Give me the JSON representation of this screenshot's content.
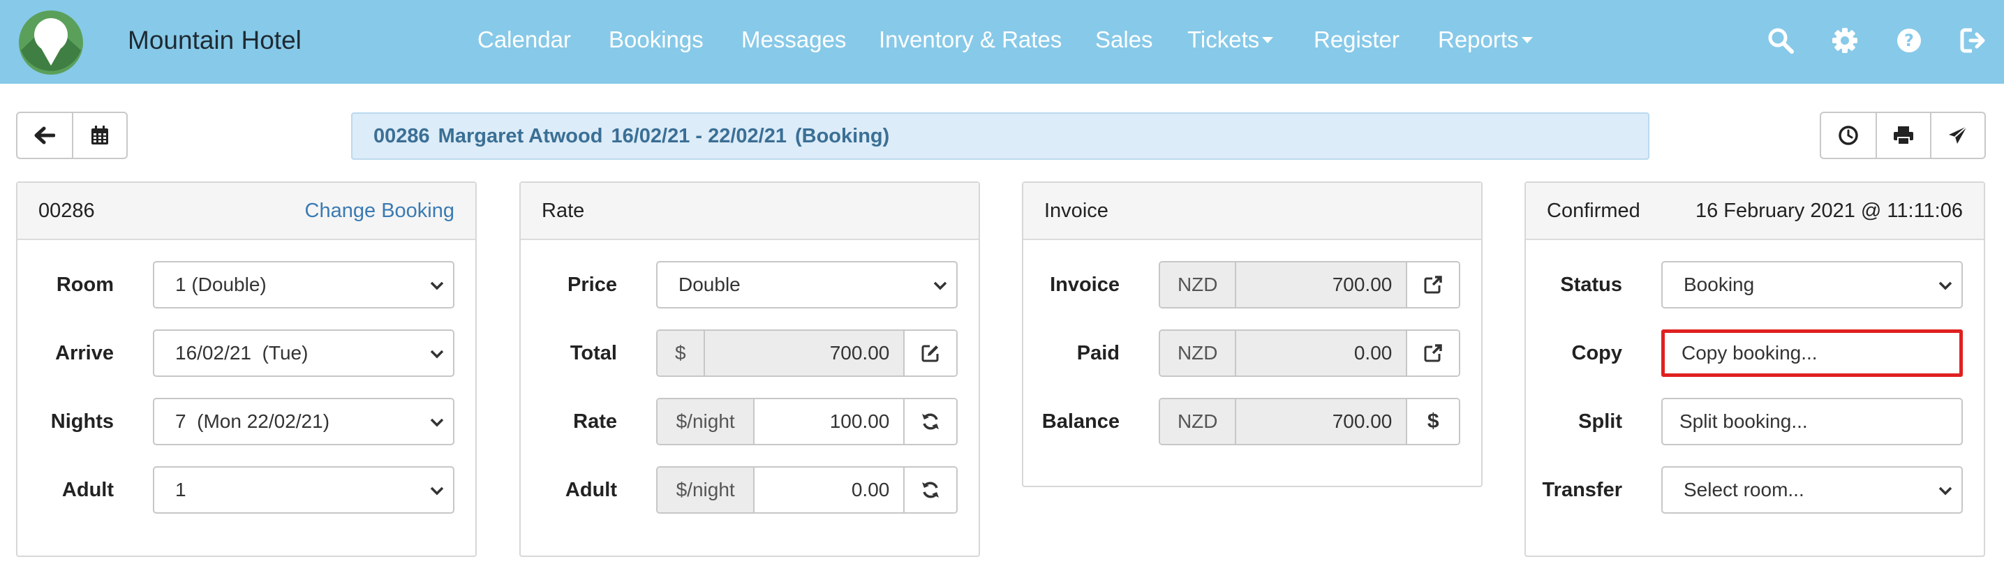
{
  "app": {
    "brand": "Mountain Hotel",
    "colors": {
      "navbar": "#87c9e8",
      "info_bar": "#dcecf8",
      "link": "#3a7ab3",
      "highlight": "#e02020"
    }
  },
  "nav": {
    "items": [
      {
        "label": "Calendar"
      },
      {
        "label": "Bookings"
      },
      {
        "label": "Messages"
      },
      {
        "label": "Inventory & Rates"
      },
      {
        "label": "Sales"
      },
      {
        "label": "Tickets",
        "dropdown": true
      },
      {
        "label": "Register"
      },
      {
        "label": "Reports",
        "dropdown": true
      }
    ],
    "icons": [
      "search-icon",
      "gear-icon",
      "help-icon",
      "logout-icon"
    ]
  },
  "toolbar": {
    "left_icons": [
      "back-arrow-icon",
      "calendar-icon"
    ],
    "right_icons": [
      "history-clock-icon",
      "print-icon",
      "send-icon"
    ]
  },
  "booking_bar": {
    "id": "00286",
    "guest": "Margaret Atwood",
    "dates": "16/02/21 - 22/02/21",
    "type": "(Booking)"
  },
  "booking_panel": {
    "title": "00286",
    "link": "Change Booking",
    "fields": [
      {
        "label": "Room",
        "value": "1 (Double)"
      },
      {
        "label": "Arrive",
        "value": "16/02/21  (Tue)"
      },
      {
        "label": "Nights",
        "value": "7  (Mon 22/02/21)"
      },
      {
        "label": "Adult",
        "value": "1"
      }
    ]
  },
  "rate_panel": {
    "title": "Rate",
    "price": {
      "label": "Price",
      "value": "Double"
    },
    "total": {
      "label": "Total",
      "prefix": "$",
      "value": "700.00",
      "action_icon": "edit-icon"
    },
    "rate": {
      "label": "Rate",
      "prefix": "$/night",
      "value": "100.00",
      "action_icon": "refresh-icon"
    },
    "adult": {
      "label": "Adult",
      "prefix": "$/night",
      "value": "0.00",
      "action_icon": "refresh-icon"
    }
  },
  "invoice_panel": {
    "title": "Invoice",
    "invoice": {
      "label": "Invoice",
      "currency": "NZD",
      "value": "700.00",
      "action_icon": "external-link-icon"
    },
    "paid": {
      "label": "Paid",
      "currency": "NZD",
      "value": "0.00",
      "action_icon": "external-link-icon"
    },
    "balance": {
      "label": "Balance",
      "currency": "NZD",
      "value": "700.00",
      "action": "$"
    }
  },
  "status_panel": {
    "title": "Confirmed",
    "timestamp": "16 February 2021 @ 11:11:06",
    "status": {
      "label": "Status",
      "value": "Booking"
    },
    "copy": {
      "label": "Copy",
      "value": "Copy booking..."
    },
    "split": {
      "label": "Split",
      "value": "Split booking..."
    },
    "transfer": {
      "label": "Transfer",
      "value": "Select room..."
    }
  }
}
